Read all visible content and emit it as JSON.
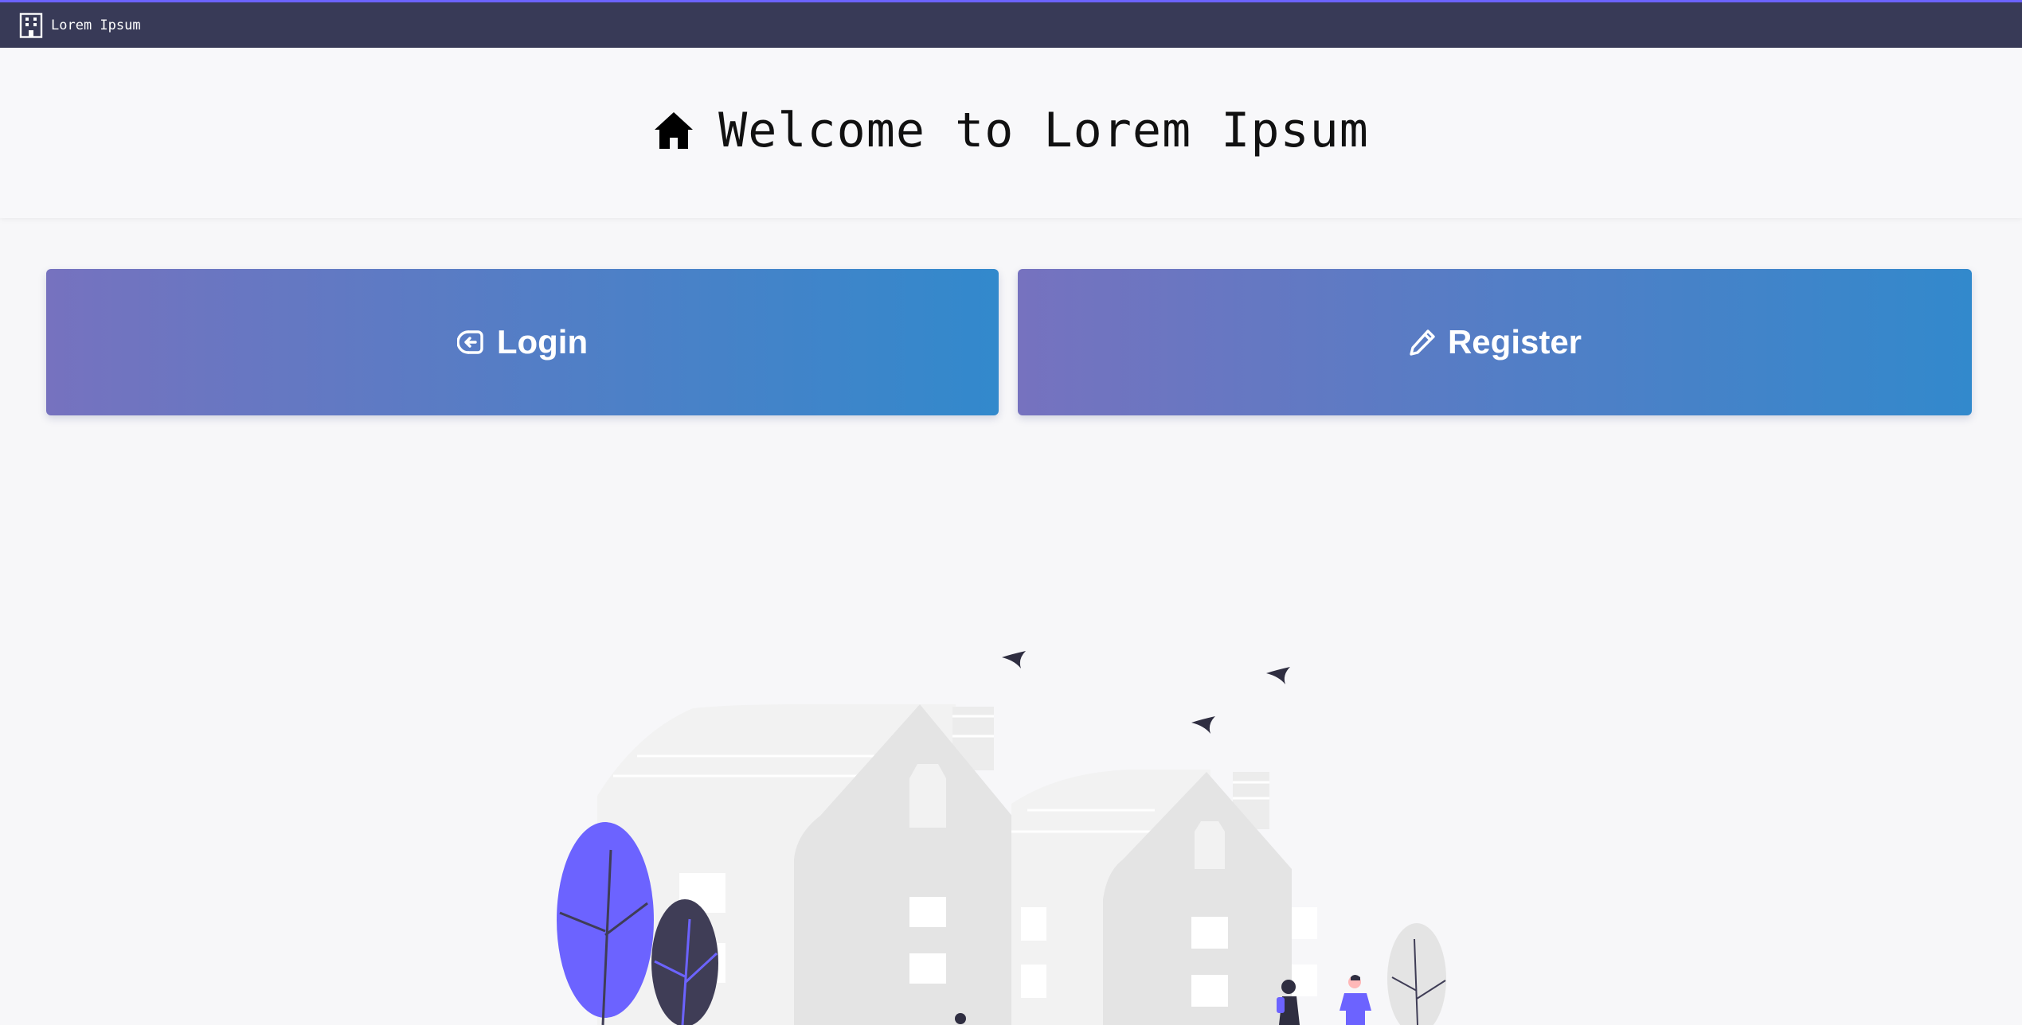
{
  "navbar": {
    "brand_icon": "building-icon",
    "brand_name": "Lorem Ipsum"
  },
  "hero": {
    "icon": "home-icon",
    "title": "Welcome to Lorem Ipsum"
  },
  "actions": {
    "login": {
      "icon": "sign-in-icon",
      "label": "Login"
    },
    "register": {
      "icon": "pencil-icon",
      "label": "Register"
    }
  },
  "colors": {
    "navbar_bg": "#383a57",
    "accent": "#6c63ff",
    "button_gradient_start": "#7672bf",
    "button_gradient_end": "#3289cc",
    "page_bg": "#f7f7f9"
  }
}
